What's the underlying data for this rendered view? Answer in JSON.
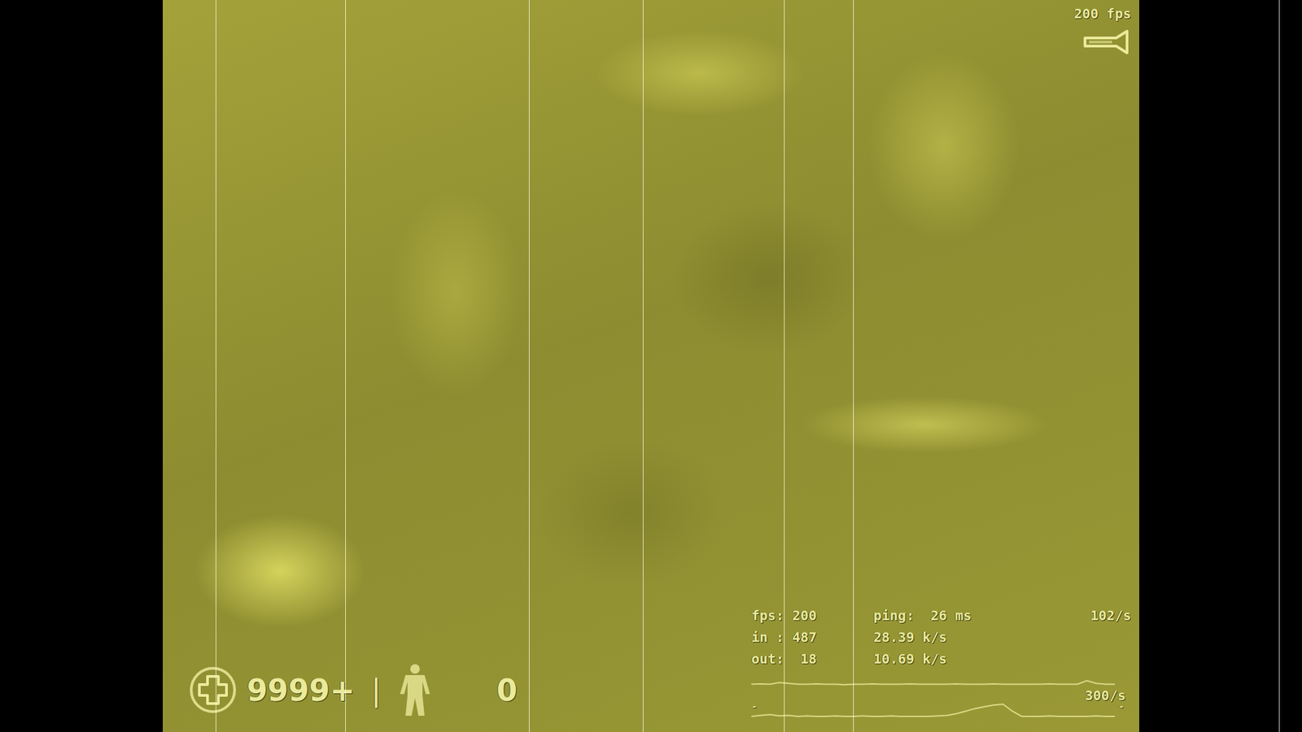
{
  "hud": {
    "fps_counter": "200 fps",
    "health": "9999+",
    "separator": "|",
    "armor": "0"
  },
  "net_stats": {
    "rows": [
      [
        "fps: 200",
        "ping:  26 ms",
        "102/s"
      ],
      [
        "in : 487",
        "28.39 k/s",
        ""
      ],
      [
        "out:  18",
        "10.69 k/s",
        ""
      ]
    ]
  },
  "net_graph": {
    "rate": "300/s",
    "left_marker": "-",
    "right_marker": "-",
    "series": [
      {
        "name": "upper",
        "values": [
          0.82,
          0.83,
          0.82,
          0.86,
          0.84,
          0.82,
          0.82,
          0.83,
          0.82,
          0.82,
          0.81,
          0.82,
          0.82,
          0.83,
          0.82,
          0.82,
          0.82,
          0.83,
          0.82,
          0.82,
          0.82,
          0.82,
          0.83,
          0.82,
          0.82,
          0.82,
          0.83,
          0.82,
          0.82,
          0.82,
          0.82,
          0.82,
          0.83,
          0.82,
          0.82,
          0.82,
          0.9,
          0.84,
          0.82,
          0.82
        ]
      },
      {
        "name": "lower",
        "values": [
          0.08,
          0.1,
          0.12,
          0.09,
          0.1,
          0.08,
          0.09,
          0.08,
          0.08,
          0.09,
          0.08,
          0.08,
          0.09,
          0.08,
          0.08,
          0.09,
          0.08,
          0.08,
          0.08,
          0.08,
          0.09,
          0.1,
          0.14,
          0.2,
          0.26,
          0.3,
          0.34,
          0.36,
          0.2,
          0.08,
          0.08,
          0.08,
          0.09,
          0.08,
          0.08,
          0.08,
          0.08,
          0.09,
          0.08,
          0.08
        ]
      }
    ]
  }
}
